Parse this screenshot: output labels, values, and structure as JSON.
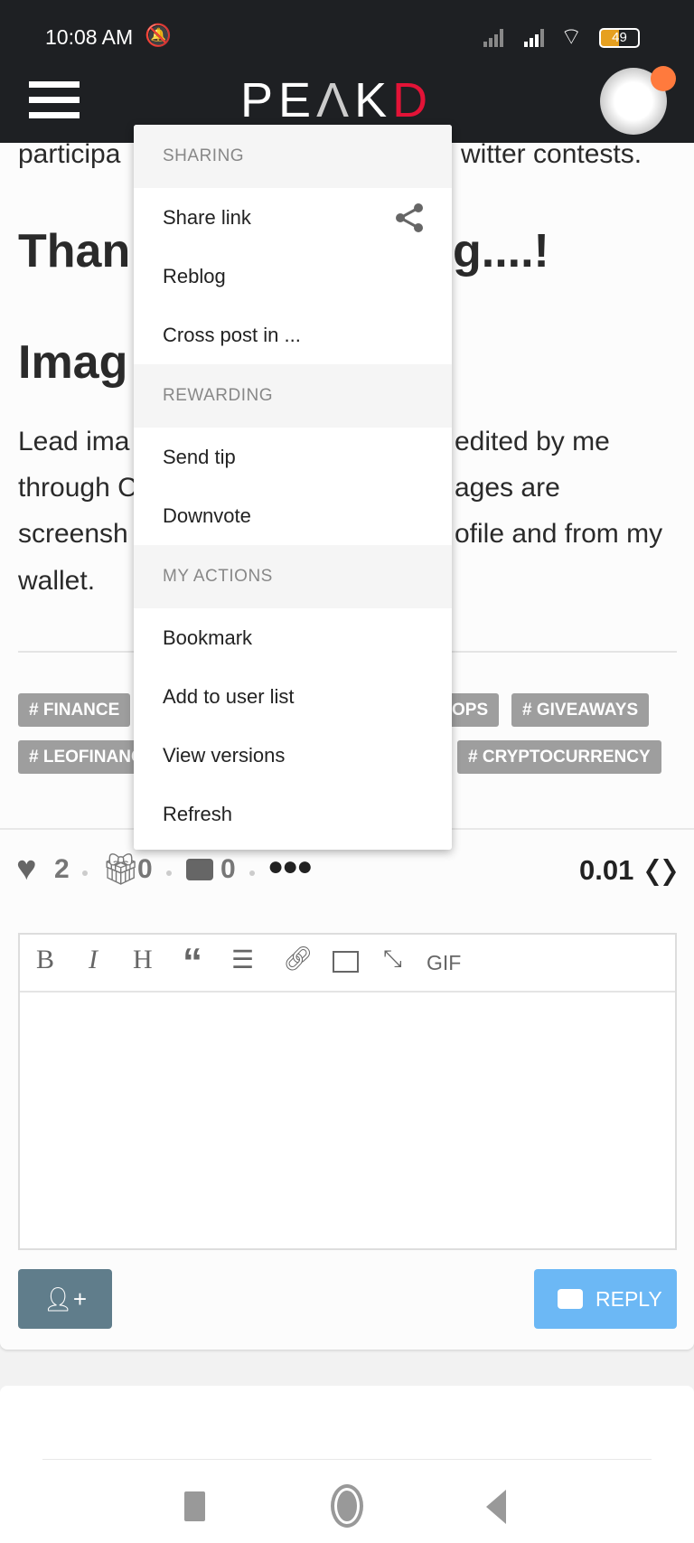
{
  "status_bar": {
    "time": "10:08 AM",
    "battery": "49"
  },
  "header": {
    "logo": "PEAKD",
    "colors": {
      "bar": "#1e2023",
      "logo_accent": "#e31337",
      "notification": "#ff7a3d"
    }
  },
  "post": {
    "line1_left": "participa",
    "line1_right": "witter contests.",
    "heading1_left": "Than",
    "heading1_right": "g....!",
    "heading2_left": "Imag",
    "para_lines": [
      {
        "left": "Lead ima",
        "right": "edited by me"
      },
      {
        "left": "through C",
        "right": "ages are"
      },
      {
        "left": "screensh",
        "right": "ofile and from my"
      },
      {
        "left": "wallet.",
        "right": ""
      }
    ],
    "tags": [
      "# FINANCE",
      "OPS",
      "# GIVEAWAYS",
      "# LEOFINANC",
      "# CRYPTOCURRENCY"
    ]
  },
  "menu": {
    "sections": [
      {
        "header": "SHARING",
        "items": [
          "Share link",
          "Reblog",
          "Cross post in ..."
        ]
      },
      {
        "header": "REWARDING",
        "items": [
          "Send tip",
          "Downvote"
        ]
      },
      {
        "header": "MY ACTIONS",
        "items": [
          "Bookmark",
          "Add to user list",
          "View versions",
          "Refresh"
        ]
      }
    ]
  },
  "actions": {
    "votes": "2",
    "tips": "0",
    "comments": "0",
    "payout": "0.01"
  },
  "editor": {
    "toolbar": [
      "B",
      "I",
      "H",
      "GIF"
    ],
    "value": ""
  },
  "buttons": {
    "reply": "REPLY",
    "colors": {
      "mention": "#607d8b",
      "reply": "#6cb8f5"
    }
  }
}
